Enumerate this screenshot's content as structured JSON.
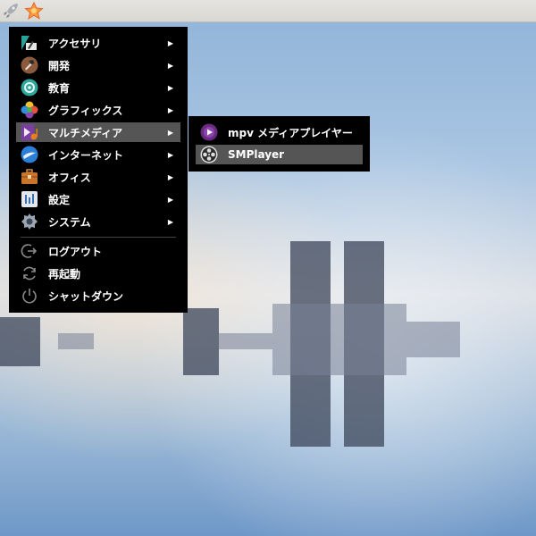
{
  "menu": {
    "items": [
      {
        "label": "アクセサリ",
        "icon": "accessories-icon",
        "has_submenu": true
      },
      {
        "label": "開発",
        "icon": "development-icon",
        "has_submenu": true
      },
      {
        "label": "教育",
        "icon": "education-icon",
        "has_submenu": true
      },
      {
        "label": "グラフィックス",
        "icon": "graphics-icon",
        "has_submenu": true
      },
      {
        "label": "マルチメディア",
        "icon": "multimedia-icon",
        "has_submenu": true,
        "active": true
      },
      {
        "label": "インターネット",
        "icon": "internet-icon",
        "has_submenu": true
      },
      {
        "label": "オフィス",
        "icon": "office-icon",
        "has_submenu": true
      },
      {
        "label": "設定",
        "icon": "settings-icon",
        "has_submenu": true
      },
      {
        "label": "システム",
        "icon": "system-icon",
        "has_submenu": true
      },
      {
        "label": "ログアウト",
        "icon": "logout-icon",
        "has_submenu": false
      },
      {
        "label": "再起動",
        "icon": "restart-icon",
        "has_submenu": false
      },
      {
        "label": "シャットダウン",
        "icon": "shutdown-icon",
        "has_submenu": false
      }
    ],
    "arrow_glyph": "▶"
  },
  "submenu": {
    "items": [
      {
        "label": "mpv メディアプレイヤー",
        "icon": "mpv-icon"
      },
      {
        "label": "SMPlayer",
        "icon": "smplayer-icon",
        "active": true
      }
    ]
  },
  "topbar": {
    "icons": [
      "rocket-launcher-icon",
      "favorites-star-icon"
    ]
  },
  "colors": {
    "menu_bg": "#000000",
    "menu_highlight": "#555555",
    "menu_text": "#ffffff",
    "mpv_purple": "#6a2a82"
  }
}
